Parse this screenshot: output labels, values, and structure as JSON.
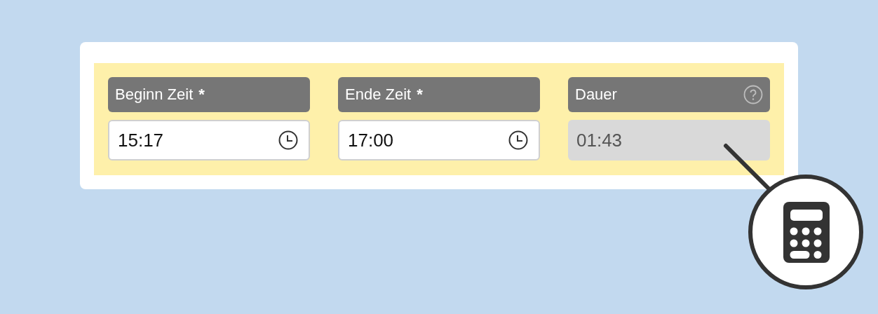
{
  "fields": [
    {
      "label": "Beginn Zeit",
      "required_mark": "*",
      "value": "15:17",
      "kind": "time"
    },
    {
      "label": "Ende Zeit",
      "required_mark": "*",
      "value": "17:00",
      "kind": "time"
    },
    {
      "label": "Dauer",
      "value": "01:43",
      "kind": "computed"
    }
  ]
}
